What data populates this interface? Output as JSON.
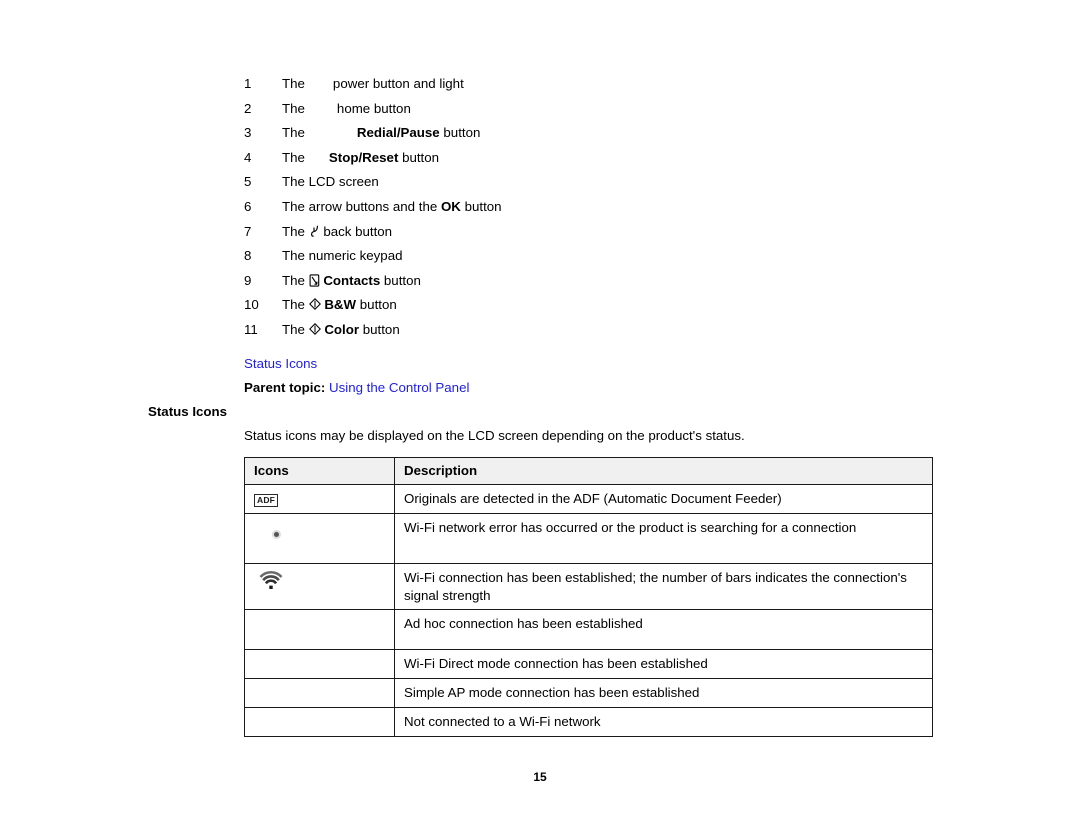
{
  "legend": {
    "items": [
      {
        "num": "1",
        "prefix": "The",
        "glyph": "power-button-icon",
        "glyph_missing": true,
        "text_plain": "power button and light",
        "bold": ""
      },
      {
        "num": "2",
        "prefix": "The",
        "glyph": "home-button-icon",
        "glyph_missing": true,
        "text_plain": "home button",
        "bold": ""
      },
      {
        "num": "3",
        "prefix": "The",
        "glyph": "redial-pause-icon",
        "glyph_missing": true,
        "bold": "Redial/Pause",
        "text_plain": " button"
      },
      {
        "num": "4",
        "prefix": "The",
        "glyph": "stop-reset-icon",
        "glyph_missing": true,
        "bold": "Stop/Reset",
        "text_plain": " button"
      },
      {
        "num": "5",
        "prefix": "The",
        "glyph": "",
        "glyph_missing": false,
        "text_plain": "LCD screen",
        "bold": ""
      },
      {
        "num": "6",
        "prefix": "The",
        "glyph": "",
        "glyph_missing": false,
        "text_pre": "arrow buttons and the ",
        "bold": "OK",
        "text_plain": " button"
      },
      {
        "num": "7",
        "prefix": "The",
        "glyph": "back-button-icon",
        "glyph_missing": false,
        "text_plain": "back button",
        "bold": ""
      },
      {
        "num": "8",
        "prefix": "The",
        "glyph": "",
        "glyph_missing": false,
        "text_plain": "numeric keypad",
        "bold": ""
      },
      {
        "num": "9",
        "prefix": "The",
        "glyph": "contacts-button-icon",
        "glyph_missing": false,
        "bold": "Contacts",
        "text_plain": " button"
      },
      {
        "num": "10",
        "prefix": "The",
        "glyph": "start-bw-button-icon",
        "glyph_missing": false,
        "bold": "B&W",
        "text_plain": " button"
      },
      {
        "num": "11",
        "prefix": "The",
        "glyph": "start-color-button-icon",
        "glyph_missing": false,
        "bold": "Color",
        "text_plain": " button"
      }
    ]
  },
  "links": {
    "child_topic": "Status Icons",
    "parent_label": "Parent topic:",
    "parent_topic": "Using the Control Panel",
    "link_color": "#2222dd"
  },
  "section": {
    "heading": "Status Icons",
    "intro": "Status icons may be displayed on the LCD screen depending on the product's status."
  },
  "table": {
    "headers": [
      "Icons",
      "Description"
    ],
    "rows": [
      {
        "icon": "adf-icon",
        "icon_label": "ADF",
        "description": "Originals are detected in the ADF (Automatic Document Feeder)"
      },
      {
        "icon": "wifi-searching-icon",
        "icon_label": "",
        "description": "Wi-Fi network error has occurred or the product is searching for a connection"
      },
      {
        "icon": "wifi-connected-icon",
        "icon_label": "",
        "description": "Wi-Fi connection has been established; the number of bars indicates the connection's signal strength"
      },
      {
        "icon": "adhoc-icon",
        "icon_label": "",
        "description": "Ad hoc connection has been established"
      },
      {
        "icon": "wifi-direct-icon",
        "icon_label": "",
        "description": "Wi-Fi Direct mode connection has been established"
      },
      {
        "icon": "simple-ap-icon",
        "icon_label": "",
        "description": "Simple AP mode connection has been established"
      },
      {
        "icon": "wifi-off-icon",
        "icon_label": "",
        "description": "Not connected to a Wi-Fi network"
      }
    ]
  },
  "footer": {
    "page_number": "15"
  }
}
